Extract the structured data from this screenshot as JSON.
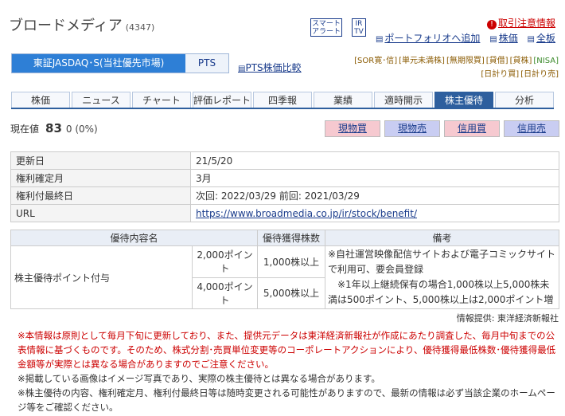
{
  "header": {
    "company_name": "ブロードメディア",
    "stock_code": "(4347)",
    "smart_alert": "スマート\nアラート",
    "irtv": "IR\nTV",
    "caution_icon": "!",
    "caution_label": "取引注意情報",
    "links": [
      {
        "icon": "portfolio-icon",
        "glyph": "▤",
        "label": "ポートフォリオへ追加"
      },
      {
        "icon": "stock-price-icon",
        "glyph": "▤",
        "label": "株価"
      },
      {
        "icon": "full-board-icon",
        "glyph": "▤",
        "label": "全板"
      }
    ]
  },
  "market": {
    "selected": "東証JASDAQ･S(当社優先市場)",
    "pts": "PTS",
    "pts_compare_icon": "▤",
    "pts_compare": "PTS株価比較"
  },
  "chips": [
    "[SOR寛･信]",
    "[単元未満株]",
    "[無期限買]",
    "[貸借]",
    "[貸株]",
    "[NISA]",
    "[日計り買]",
    "[日計り売]"
  ],
  "tabs": [
    "株価",
    "ニュース",
    "チャート",
    "評価レポート",
    "四季報",
    "業績",
    "適時開示",
    "株主優待",
    "分析"
  ],
  "active_tab": "株主優待",
  "quote": {
    "label": "現在値",
    "price": "83",
    "change": "0 (0%)"
  },
  "trade_buttons": [
    "現物買",
    "現物売",
    "信用買",
    "信用売"
  ],
  "info_rows": [
    {
      "key": "更新日",
      "value": "21/5/20"
    },
    {
      "key": "権利確定月",
      "value": "3月"
    },
    {
      "key": "権利付最終日",
      "value": "次回: 2022/03/29 前回: 2021/03/29"
    },
    {
      "key": "URL",
      "value": "https://www.broadmedia.co.jp/ir/stock/benefit/"
    }
  ],
  "yutai_table": {
    "headers": [
      "優待内容名",
      "優待獲得株数",
      "備考"
    ],
    "name": "株主優待ポイント付与",
    "rows": [
      {
        "points": "2,000ポイント",
        "condition": "1,000株以上"
      },
      {
        "points": "4,000ポイント",
        "condition": "5,000株以上"
      }
    ],
    "note": "※自社運営映像配信サイトおよび電子コミックサイトで利用可、要会員登録\n　※1年以上継続保有の場合1,000株以上5,000株未満は500ポイント、5,000株以上は2,000ポイント増"
  },
  "provider": "情報提供: 東洋経済新報社",
  "notes": {
    "red": "※本情報は原則として毎月下旬に更新しており、また、提供元データは東洋経済新報社が作成にあたり調査した、毎月中旬までの公表情報に基づくものです。そのため、株式分割･売買単位変更等のコーポレートアクションにより、優待獲得最低株数･優待獲得最低金額等が実際とは異なる場合がありますのでご注意ください。",
    "n1": "※掲載している画像はイメージ写真であり、実際の株主優待とは異なる場合があります。",
    "n2": "※株主優待の内容、権利確定月、権利付最終日等は随時変更される可能性がありますので、最新の情報は必ず当該企業のホームページ等をご確認ください。"
  },
  "colors": {
    "accent": "#2e5f9e",
    "market_selected": "#2e7fd6",
    "buy": "#f6c9d0",
    "sell": "#c9cdf2",
    "warning": "#cc0000"
  }
}
